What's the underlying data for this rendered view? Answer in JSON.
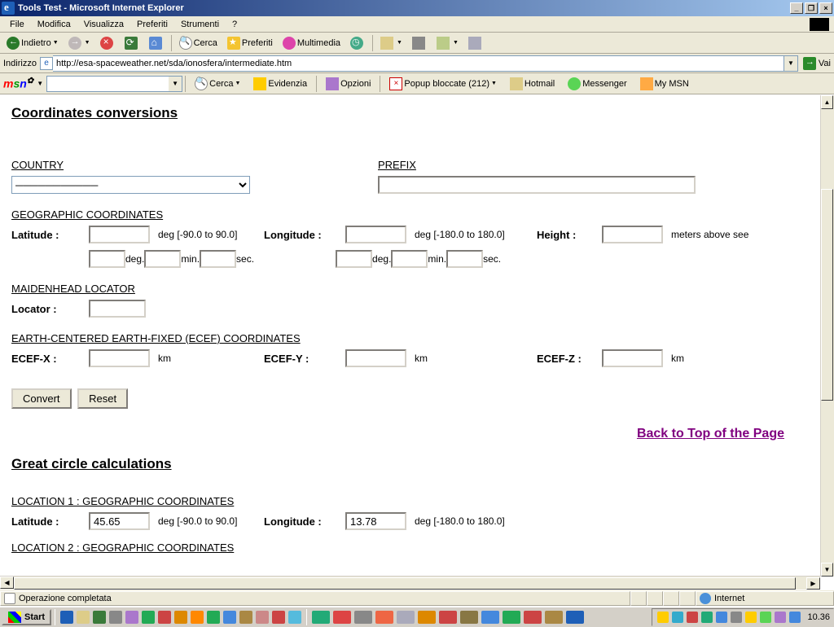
{
  "window": {
    "title": "Tools Test - Microsoft Internet Explorer"
  },
  "menu": {
    "file": "File",
    "edit": "Modifica",
    "view": "Visualizza",
    "favorites": "Preferiti",
    "tools": "Strumenti",
    "help": "?"
  },
  "toolbar": {
    "back": "Indietro",
    "search": "Cerca",
    "favorites": "Preferiti",
    "multimedia": "Multimedia"
  },
  "address": {
    "label": "Indirizzo",
    "url": "http://esa-spaceweather.net/sda/ionosfera/intermediate.htm",
    "go": "Vai"
  },
  "msn": {
    "search": "Cerca",
    "highlight": "Evidenzia",
    "options": "Opzioni",
    "popup": "Popup bloccate (212)",
    "hotmail": "Hotmail",
    "messenger": "Messenger",
    "mymsn": "My MSN"
  },
  "page": {
    "h_coord": "Coordinates conversions",
    "country": "COUNTRY",
    "prefix": "PREFIX",
    "prefix_val": "",
    "geo": "GEOGRAPHIC COORDINATES",
    "lat": "Latitude :",
    "lat_hint": "deg [-90.0 to 90.0]",
    "lon": "Longitude :",
    "lon_hint": "deg [-180.0 to 180.0]",
    "height": "Height :",
    "height_hint": "meters above see",
    "deg": "deg.",
    "min": "min.",
    "sec": "sec.",
    "maiden": "MAIDENHEAD LOCATOR",
    "locator": "Locator :",
    "ecef": "EARTH-CENTERED EARTH-FIXED (ECEF) COORDINATES",
    "ecefx": "ECEF-X :",
    "ecefy": "ECEF-Y :",
    "ecefz": "ECEF-Z :",
    "km": "km",
    "convert": "Convert",
    "reset": "Reset",
    "backtop": "Back to Top of the Page",
    "h_gc": "Great circle calculations",
    "loc1": "LOCATION 1 : GEOGRAPHIC COORDINATES",
    "loc2": "LOCATION 2 : GEOGRAPHIC COORDINATES",
    "gc_lat_val": "45.65",
    "gc_lon_val": "13.78"
  },
  "status": {
    "text": "Operazione completata",
    "zone": "Internet"
  },
  "taskbar": {
    "start": "Start",
    "clock": "10.36"
  }
}
